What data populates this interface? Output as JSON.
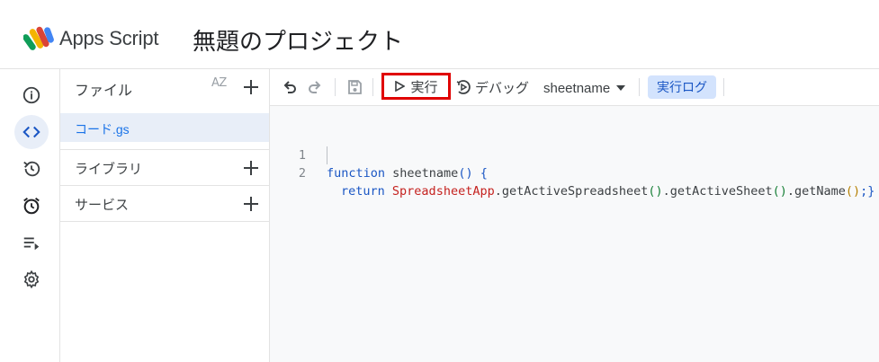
{
  "header": {
    "brand": "Apps Script",
    "project_title": "無題のプロジェクト",
    "logo_colors": [
      "#0f9d58",
      "#f4b400",
      "#db4437",
      "#4285f4"
    ]
  },
  "rail": {
    "items": [
      {
        "name": "overview",
        "icon": "info-icon"
      },
      {
        "name": "editor",
        "icon": "code-icon",
        "active": true
      },
      {
        "name": "history",
        "icon": "history-icon"
      },
      {
        "name": "triggers",
        "icon": "alarm-icon"
      },
      {
        "name": "executions",
        "icon": "executions-icon"
      },
      {
        "name": "settings",
        "icon": "gear-icon"
      }
    ]
  },
  "files": {
    "title": "ファイル",
    "sort_label": "AZ",
    "items": [
      {
        "label": "コード.gs",
        "selected": true
      }
    ],
    "libraries_label": "ライブラリ",
    "services_label": "サービス"
  },
  "toolbar": {
    "run_label": "実行",
    "debug_label": "デバッグ",
    "function_selected": "sheetname",
    "log_label": "実行ログ",
    "highlight_color": "#e00000"
  },
  "code": {
    "lines": [
      {
        "number": "1"
      },
      {
        "number": "2"
      }
    ],
    "line1": {
      "kw": "function",
      "name": " sheetname",
      "p": "()",
      "rest": " {"
    },
    "line2": {
      "kw": "return",
      "cls": "SpreadsheetApp",
      "m1": ".getActiveSpreadsheet",
      "p1": "()",
      "m2": ".getActiveSheet",
      "p2": "()",
      "m3": ".getName",
      "p3": "()",
      "end": ";}"
    }
  }
}
